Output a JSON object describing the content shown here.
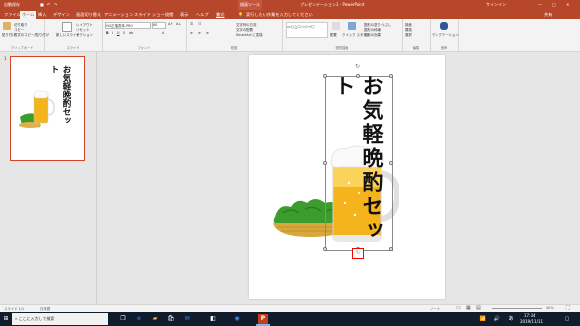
{
  "titlebar": {
    "autosave": "自動保存",
    "context_tab": "描画ツール",
    "doc_title": "プレゼンテーション1 - PowerPoint",
    "user": "サインイン"
  },
  "tabs": [
    {
      "label": "ファイル"
    },
    {
      "label": "ホーム"
    },
    {
      "label": "挿入"
    },
    {
      "label": "デザイン"
    },
    {
      "label": "画面切り替え"
    },
    {
      "label": "アニメーション"
    },
    {
      "label": "スライド ショー"
    },
    {
      "label": "校閲"
    },
    {
      "label": "表示"
    },
    {
      "label": "ヘルプ"
    },
    {
      "label": "書式"
    }
  ],
  "tell_me": "実行したい作業を入力してください",
  "share_label": "共有",
  "ribbon": {
    "groups": {
      "clipboard": "クリップボード",
      "slides": "スライド",
      "font": "フォント",
      "paragraph": "段落",
      "drawing": "図形描画",
      "editing": "編集",
      "voice": "音声"
    },
    "paste": "貼り付け",
    "cut": "切り取り",
    "copy": "コピー",
    "format_painter": "書式のコピー/貼り付け",
    "new_slide": "新しいスライド",
    "layout": "レイアウト",
    "reset": "リセット",
    "section": "セクション",
    "font_name": "HG正楷書体-PRO",
    "font_size": "60",
    "text_direction": "文字列の方向",
    "align_text": "文字の配置",
    "smartart": "SmartArt に変換",
    "arrange": "配置",
    "quick_styles": "クイック スタイル",
    "shape_fill": "図形の塗りつぶし",
    "shape_outline": "図形の枠線",
    "shape_effects": "図形の効果",
    "find": "検索",
    "replace": "置換",
    "select": "選択",
    "dictate": "ディクテーション"
  },
  "thumb": {
    "number": "1",
    "line1": "お気軽晩酌セッ",
    "line2": "ト"
  },
  "slide": {
    "line1": "お気軽晩酌セッ",
    "line2": "ト"
  },
  "status": {
    "slide_count": "スライド 1/1",
    "language": "日本語",
    "notes": "ノート",
    "zoom": "40%"
  },
  "taskbar": {
    "search_placeholder": "ここに入力して検索",
    "time": "17:34",
    "date": "2019/11/11"
  },
  "colors": {
    "accent": "#b7472a",
    "taskbar": "#101c2c",
    "selection_red": "#ff0000"
  }
}
